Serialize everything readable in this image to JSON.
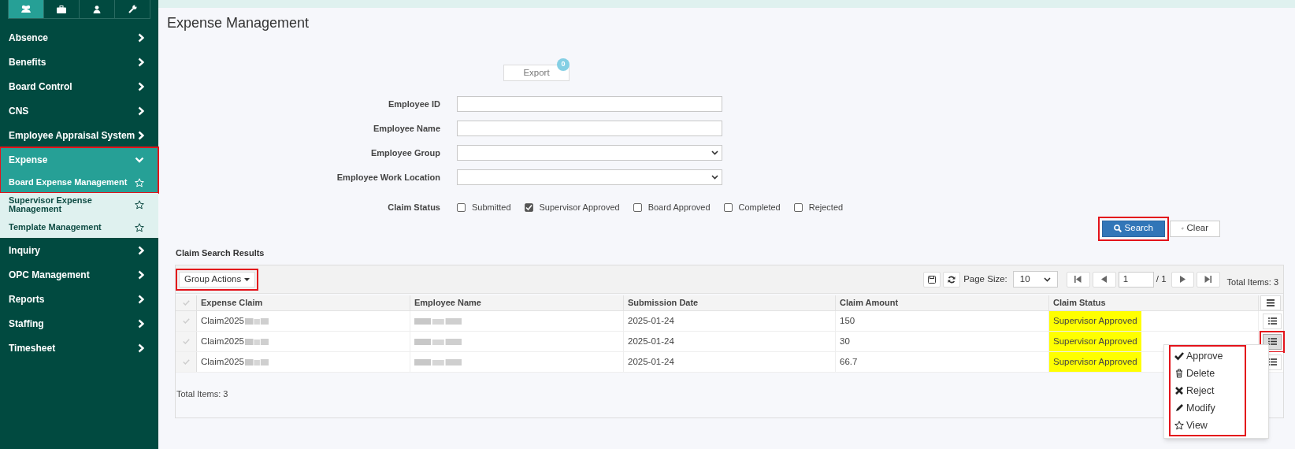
{
  "sidebar": {
    "tabs": [
      {
        "kind": "people",
        "selected": true
      },
      {
        "kind": "briefcase",
        "selected": false
      },
      {
        "kind": "person",
        "selected": false
      },
      {
        "kind": "wrench",
        "selected": false
      }
    ],
    "items": [
      {
        "label": "Absence",
        "expanded": false
      },
      {
        "label": "Benefits",
        "expanded": false
      },
      {
        "label": "Board Control",
        "expanded": false
      },
      {
        "label": "CNS",
        "expanded": false
      },
      {
        "label": "Employee Appraisal System",
        "expanded": false
      },
      {
        "label": "Expense",
        "expanded": true,
        "highlighted": true,
        "children": [
          {
            "label": "Board Expense Management",
            "selected": true
          },
          {
            "label": "Supervisor Expense Management",
            "selected": false
          },
          {
            "label": "Template Management",
            "selected": false
          }
        ]
      },
      {
        "label": "Inquiry",
        "expanded": false
      },
      {
        "label": "OPC Management",
        "expanded": false
      },
      {
        "label": "Reports",
        "expanded": false
      },
      {
        "label": "Staffing",
        "expanded": false
      },
      {
        "label": "Timesheet",
        "expanded": false
      }
    ]
  },
  "page_title": "Expense Management",
  "export": {
    "label": "Export",
    "badge": "0"
  },
  "filters": [
    {
      "label": "Employee ID",
      "kind": "text"
    },
    {
      "label": "Employee Name",
      "kind": "text"
    },
    {
      "label": "Employee Group",
      "kind": "select"
    },
    {
      "label": "Employee Work Location",
      "kind": "select"
    }
  ],
  "claim_status": {
    "label": "Claim Status",
    "options": [
      {
        "label": "Submitted",
        "checked": false
      },
      {
        "label": "Supervisor Approved",
        "checked": true
      },
      {
        "label": "Board Approved",
        "checked": false
      },
      {
        "label": "Completed",
        "checked": false
      },
      {
        "label": "Rejected",
        "checked": false
      }
    ]
  },
  "buttons": [
    {
      "label": "Search",
      "kind": "primary",
      "highlighted": true
    },
    {
      "label": "Clear",
      "kind": "default"
    }
  ],
  "results": {
    "title": "Claim Search Results",
    "group_actions": {
      "label": "Group Actions",
      "highlighted": true
    },
    "page_size_label": "Page Size:",
    "page_size": "10",
    "page": "1",
    "page_total": "/ 1",
    "total_items": "Total Items: 3",
    "columns": [
      "Expense Claim",
      "Employee Name",
      "Submission Date",
      "Claim Amount",
      "Claim Status"
    ],
    "rows": [
      {
        "expense_claim": "Claim2025",
        "submission_date": "2025-01-24",
        "claim_amount": "150",
        "claim_status": "Supervisor Approved",
        "status_highlighted": true,
        "action_highlighted": false
      },
      {
        "expense_claim": "Claim2025",
        "submission_date": "2025-01-24",
        "claim_amount": "30",
        "claim_status": "Supervisor Approved",
        "status_highlighted": true,
        "action_highlighted": true
      },
      {
        "expense_claim": "Claim2025",
        "submission_date": "2025-01-24",
        "claim_amount": "66.7",
        "claim_status": "Supervisor Approved",
        "status_highlighted": true,
        "action_highlighted": false
      }
    ],
    "footer_total": "Total Items: 3"
  },
  "action_menu": {
    "highlighted": true,
    "items": [
      {
        "label": "Approve",
        "kind": "check"
      },
      {
        "label": "Delete",
        "kind": "trash"
      },
      {
        "label": "Reject",
        "kind": "cross"
      },
      {
        "label": "Modify",
        "kind": "pencil"
      },
      {
        "label": "View",
        "kind": "star"
      }
    ]
  }
}
